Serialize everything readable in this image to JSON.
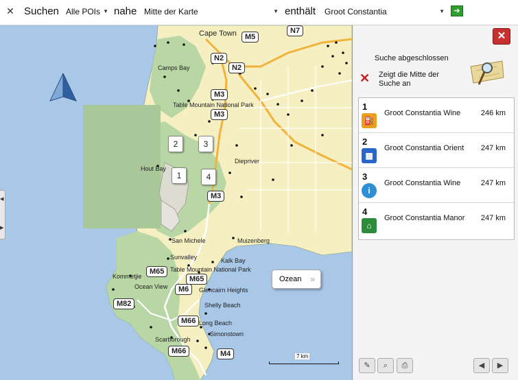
{
  "toolbar": {
    "close_icon": "close-icon",
    "search_label": "Suchen",
    "category_value": "Alle POIs",
    "near_label": "nahe",
    "location_value": "Mitte der Karte",
    "contains_label": "enthält",
    "query_value": "Groot Constantia",
    "go_icon": "arrow-right-icon"
  },
  "map": {
    "labels": {
      "cape_town": "Cape Town",
      "camps_bay": "Camps Bay",
      "table_mountain_np_1": "Table Mountain National Park",
      "hout_bay": "Hout Bay",
      "diepriver": "Diepriver",
      "san_michele": "San Michele",
      "muizenberg": "Muizenberg",
      "sunvalley": "Sunvalley",
      "kalk_bay": "Kalk Bay",
      "table_mountain_np_2": "Table Mountain National Park",
      "kommetjie": "Kommetjie",
      "ocean_view": "Ocean View",
      "glencairn_heights": "Glencairn Heights",
      "shelly_beach": "Shelly Beach",
      "long_beach": "Long Beach",
      "simonstown": "Simonstown",
      "scarborough": "Scarborough"
    },
    "roads": {
      "m5": "M5",
      "n7": "N7",
      "n2a": "N2",
      "n2b": "N2",
      "m3a": "M3",
      "m3b": "M3",
      "m3c": "M3",
      "m65a": "M65",
      "m65b": "M65",
      "m6": "M6",
      "m82": "M82",
      "m66a": "M66",
      "m66b": "M66",
      "m4": "M4"
    },
    "pins": [
      "2",
      "3",
      "1",
      "4"
    ],
    "callout_label": "Ozean",
    "callout_arrow": "»",
    "scale_label": "7 km"
  },
  "panel": {
    "close_icon": "close-icon",
    "status": "Suche abgeschlossen",
    "center_line1": "Zeigt die Mitte der",
    "center_line2": "Suche an",
    "results": [
      {
        "num": "1",
        "name": "Groot Constantia Wine",
        "dist": "246 km",
        "icon": "restaurant-icon",
        "color": "#e6a21c"
      },
      {
        "num": "2",
        "name": "Groot  Constantia Orient",
        "dist": "247 km",
        "icon": "building-icon",
        "color": "#2a66c8"
      },
      {
        "num": "3",
        "name": "Groot Constantia Wine",
        "dist": "247 km",
        "icon": "info-icon",
        "color": "#2d8fd6"
      },
      {
        "num": "4",
        "name": "Groot Constantia Manor",
        "dist": "247 km",
        "icon": "hotel-icon",
        "color": "#2e8b3a"
      }
    ]
  }
}
